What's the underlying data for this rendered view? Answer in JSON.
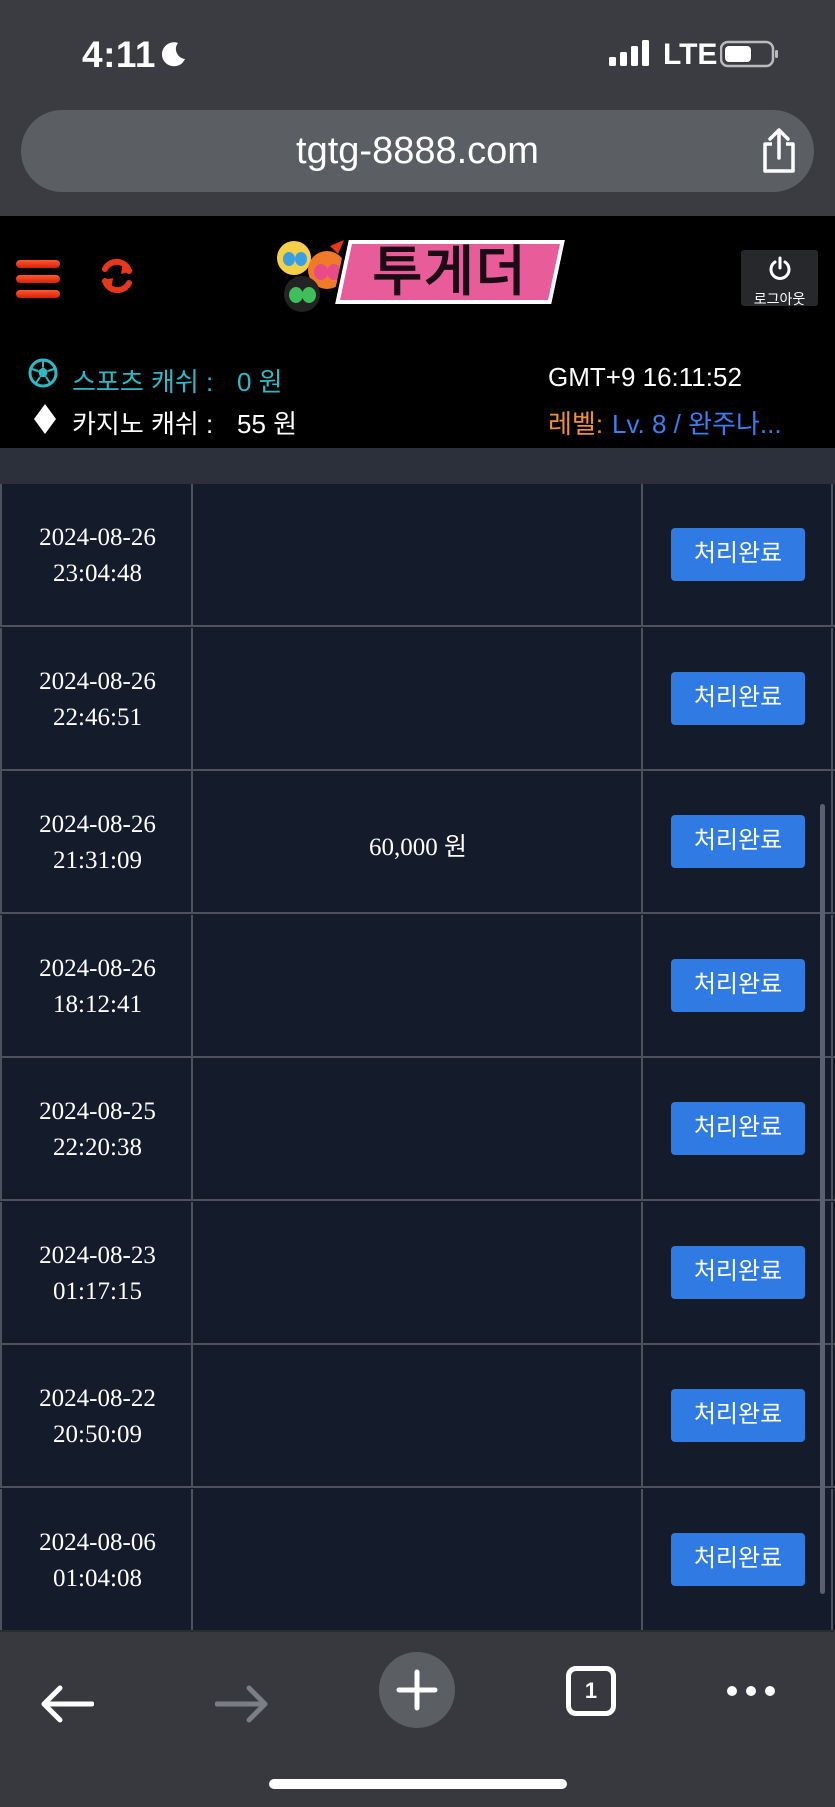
{
  "status_bar": {
    "time": "4:11",
    "network": "LTE"
  },
  "browser": {
    "url": "tgtg-8888.com"
  },
  "site": {
    "logo_text": "투게더",
    "logout_label": "로그아웃",
    "sports_cash_label": "스포츠 캐쉬 :",
    "sports_cash_value": "0 원",
    "casino_cash_label": "카지노 캐쉬 :",
    "casino_cash_value": "55 원",
    "server_time": "GMT+9 16:11:52",
    "level_label": "레벨:",
    "level_value": "Lv. 8 / 완주나..."
  },
  "table": {
    "rows": [
      {
        "date": "2024-08-26",
        "time": "23:04:48",
        "amount": "",
        "status": "처리완료"
      },
      {
        "date": "2024-08-26",
        "time": "22:46:51",
        "amount": "",
        "status": "처리완료"
      },
      {
        "date": "2024-08-26",
        "time": "21:31:09",
        "amount": "60,000 원",
        "status": "처리완료"
      },
      {
        "date": "2024-08-26",
        "time": "18:12:41",
        "amount": "",
        "status": "처리완료"
      },
      {
        "date": "2024-08-25",
        "time": "22:20:38",
        "amount": "",
        "status": "처리완료"
      },
      {
        "date": "2024-08-23",
        "time": "01:17:15",
        "amount": "",
        "status": "처리완료"
      },
      {
        "date": "2024-08-22",
        "time": "20:50:09",
        "amount": "",
        "status": "처리완료"
      },
      {
        "date": "2024-08-06",
        "time": "01:04:08",
        "amount": "",
        "status": "처리완료"
      }
    ]
  },
  "toolbar": {
    "tab_count": "1"
  },
  "colors": {
    "accent_button": "#2f7be3",
    "sports_cash": "#2fb9c4",
    "level_label": "#f0903a",
    "level_value": "#3b7ff0"
  }
}
